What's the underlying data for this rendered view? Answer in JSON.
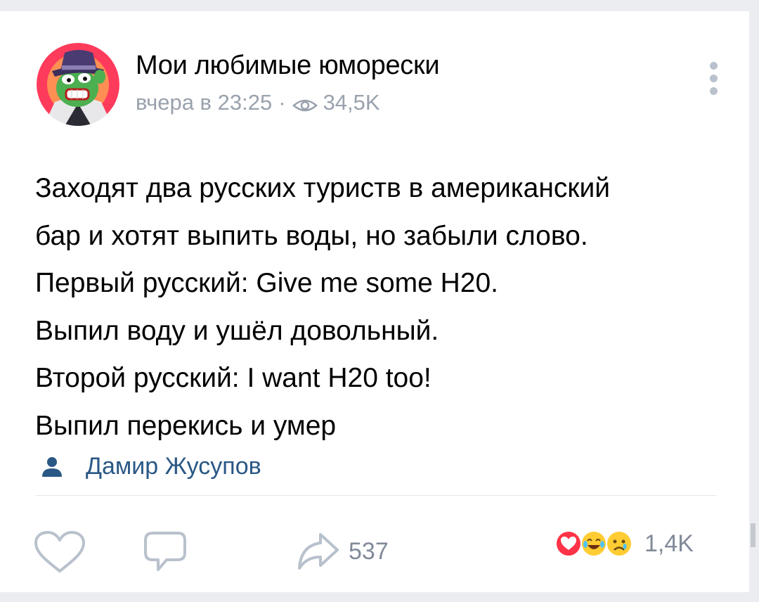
{
  "post": {
    "community_name": "Мои любимые юморески",
    "time": "вчера в 23:25",
    "separator": "·",
    "views": "34,5K",
    "lines": [
      "Заходят два русских туриств в американский",
      "бар и хотят выпить воды, но забыли слово.",
      "Первый русский: Give me some H20.",
      "Выпил воду и ушёл довольный.",
      "Второй русский: I want H20 too!",
      "Выпил перекись и умер"
    ],
    "author": "Дамир Жусупов"
  },
  "actions": {
    "share_count": "537",
    "reactions_count": "1,4K",
    "reactions": [
      "heart-reaction-icon",
      "laughing-tears-icon",
      "sad-tear-icon"
    ]
  },
  "colors": {
    "link": "#2a5885",
    "muted": "#99a2ad",
    "icon": "#b8c1cc",
    "like_red": "#ff3347",
    "emoji_yellow": "#ffcc33"
  }
}
